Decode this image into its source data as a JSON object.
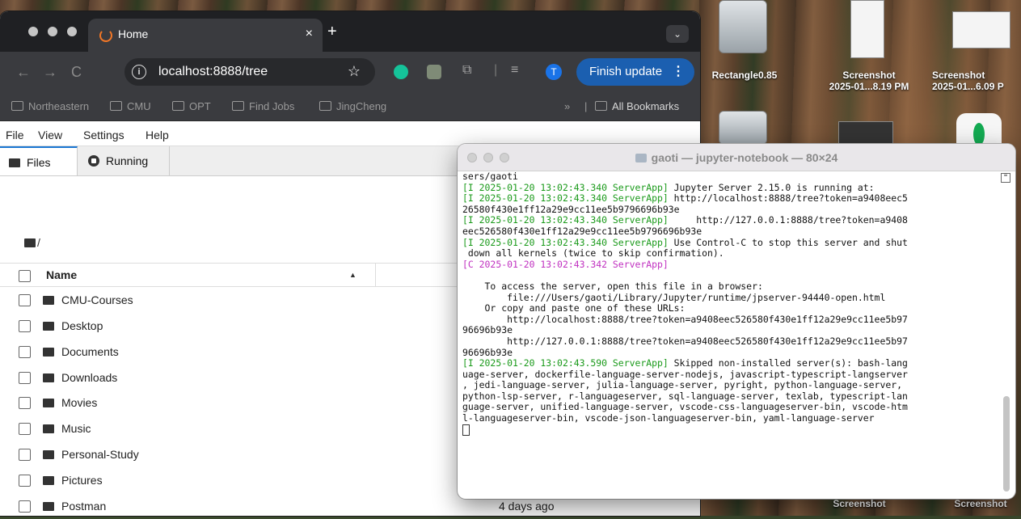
{
  "browser": {
    "tab_title": "Home",
    "tab_close": "×",
    "new_tab": "+",
    "tab_menu": "⌄",
    "nav_back": "←",
    "nav_forward": "→",
    "nav_reload": "C",
    "info_icon": "i",
    "url": "localhost:8888/tree",
    "star": "☆",
    "avatar_letter": "T",
    "finish_update": "Finish update",
    "finish_dots": "⋮",
    "ext_separator": "|",
    "bookmarks": [
      "Northeastern",
      "CMU",
      "OPT",
      "Find Jobs",
      "JingCheng"
    ],
    "bookmarks_overflow": "»",
    "bookmarks_separator": "|",
    "all_bookmarks": "All Bookmarks"
  },
  "jupyter": {
    "menu": [
      "File",
      "View",
      "Settings",
      "Help"
    ],
    "tabs": {
      "files": "Files",
      "running": "Running"
    },
    "breadcrumb": "/",
    "header_name": "Name",
    "sort_icon": "▲",
    "rows": [
      {
        "name": "CMU-Courses",
        "date": ""
      },
      {
        "name": "Desktop",
        "date": ""
      },
      {
        "name": "Documents",
        "date": ""
      },
      {
        "name": "Downloads",
        "date": ""
      },
      {
        "name": "Movies",
        "date": ""
      },
      {
        "name": "Music",
        "date": ""
      },
      {
        "name": "Personal-Study",
        "date": ""
      },
      {
        "name": "Pictures",
        "date": ""
      },
      {
        "name": "Postman",
        "date": "4 days ago"
      }
    ]
  },
  "terminal": {
    "title": "gaoti — jupyter-notebook — 80×24",
    "lines": [
      {
        "t": "sers/gaoti",
        "c": ""
      },
      {
        "t": "[I 2025-01-20 13:02:43.340 ServerApp]",
        "c": "g",
        "r": " Jupyter Server 2.15.0 is running at:"
      },
      {
        "t": "[I 2025-01-20 13:02:43.340 ServerApp]",
        "c": "g",
        "r": " http://localhost:8888/tree?token=a9408eec5"
      },
      {
        "t": "26580f430e1ff12a29e9cc11ee5b9796696b93e",
        "c": ""
      },
      {
        "t": "[I 2025-01-20 13:02:43.340 ServerApp]",
        "c": "g",
        "r": "     http://127.0.0.1:8888/tree?token=a9408"
      },
      {
        "t": "eec526580f430e1ff12a29e9cc11ee5b9796696b93e",
        "c": ""
      },
      {
        "t": "[I 2025-01-20 13:02:43.340 ServerApp]",
        "c": "g",
        "r": " Use Control-C to stop this server and shut"
      },
      {
        "t": " down all kernels (twice to skip confirmation).",
        "c": ""
      },
      {
        "t": "[C 2025-01-20 13:02:43.342 ServerApp]",
        "c": "m"
      },
      {
        "t": "",
        "c": ""
      },
      {
        "t": "    To access the server, open this file in a browser:",
        "c": ""
      },
      {
        "t": "        file:///Users/gaoti/Library/Jupyter/runtime/jpserver-94440-open.html",
        "c": ""
      },
      {
        "t": "    Or copy and paste one of these URLs:",
        "c": ""
      },
      {
        "t": "        http://localhost:8888/tree?token=a9408eec526580f430e1ff12a29e9cc11ee5b97",
        "c": ""
      },
      {
        "t": "96696b93e",
        "c": ""
      },
      {
        "t": "        http://127.0.0.1:8888/tree?token=a9408eec526580f430e1ff12a29e9cc11ee5b97",
        "c": ""
      },
      {
        "t": "96696b93e",
        "c": ""
      },
      {
        "t": "[I 2025-01-20 13:02:43.590 ServerApp]",
        "c": "g",
        "r": " Skipped non-installed server(s): bash-lang"
      },
      {
        "t": "uage-server, dockerfile-language-server-nodejs, javascript-typescript-langserver",
        "c": ""
      },
      {
        "t": ", jedi-language-server, julia-language-server, pyright, python-language-server,",
        "c": ""
      },
      {
        "t": "python-lsp-server, r-languageserver, sql-language-server, texlab, typescript-lan",
        "c": ""
      },
      {
        "t": "guage-server, unified-language-server, vscode-css-languageserver-bin, vscode-htm",
        "c": ""
      },
      {
        "t": "l-languageserver-bin, vscode-json-languageserver-bin, yaml-language-server",
        "c": ""
      }
    ]
  },
  "desktop": {
    "icons": [
      {
        "label": "Rectangle0.85"
      },
      {
        "label": "Screenshot\n2025-01...8.19 PM"
      },
      {
        "label": "Screenshot\n2025-01...6.09 P"
      },
      {
        "label": "Screenshot"
      },
      {
        "label": "Screenshot"
      }
    ]
  }
}
